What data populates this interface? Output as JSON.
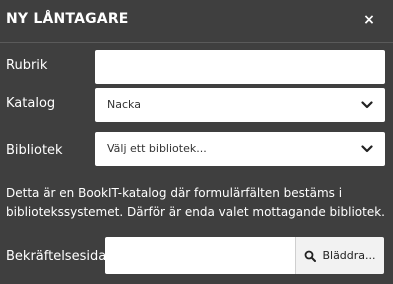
{
  "dialog": {
    "title": "NY LÅNTAGARE",
    "close_label": "×"
  },
  "form": {
    "rubrik": {
      "label": "Rubrik",
      "value": ""
    },
    "katalog": {
      "label": "Katalog",
      "selected": "Nacka"
    },
    "bibliotek": {
      "label": "Bibliotek",
      "selected": "Välj ett bibliotek..."
    },
    "info_text": "Detta är en BookIT-katalog där formulärfälten bestäms i bibliotekssystemet. Därför är enda valet mottagande bibliotek.",
    "bekraftelse": {
      "label": "Bekräftelsesida",
      "value": "",
      "browse_label": "Bläddra..."
    }
  },
  "icons": {
    "close": "close-icon",
    "chevron": "chevron-down-icon",
    "search": "search-icon"
  },
  "colors": {
    "background": "#3f3f3f",
    "field": "#ffffff",
    "button": "#f2f2f2"
  }
}
